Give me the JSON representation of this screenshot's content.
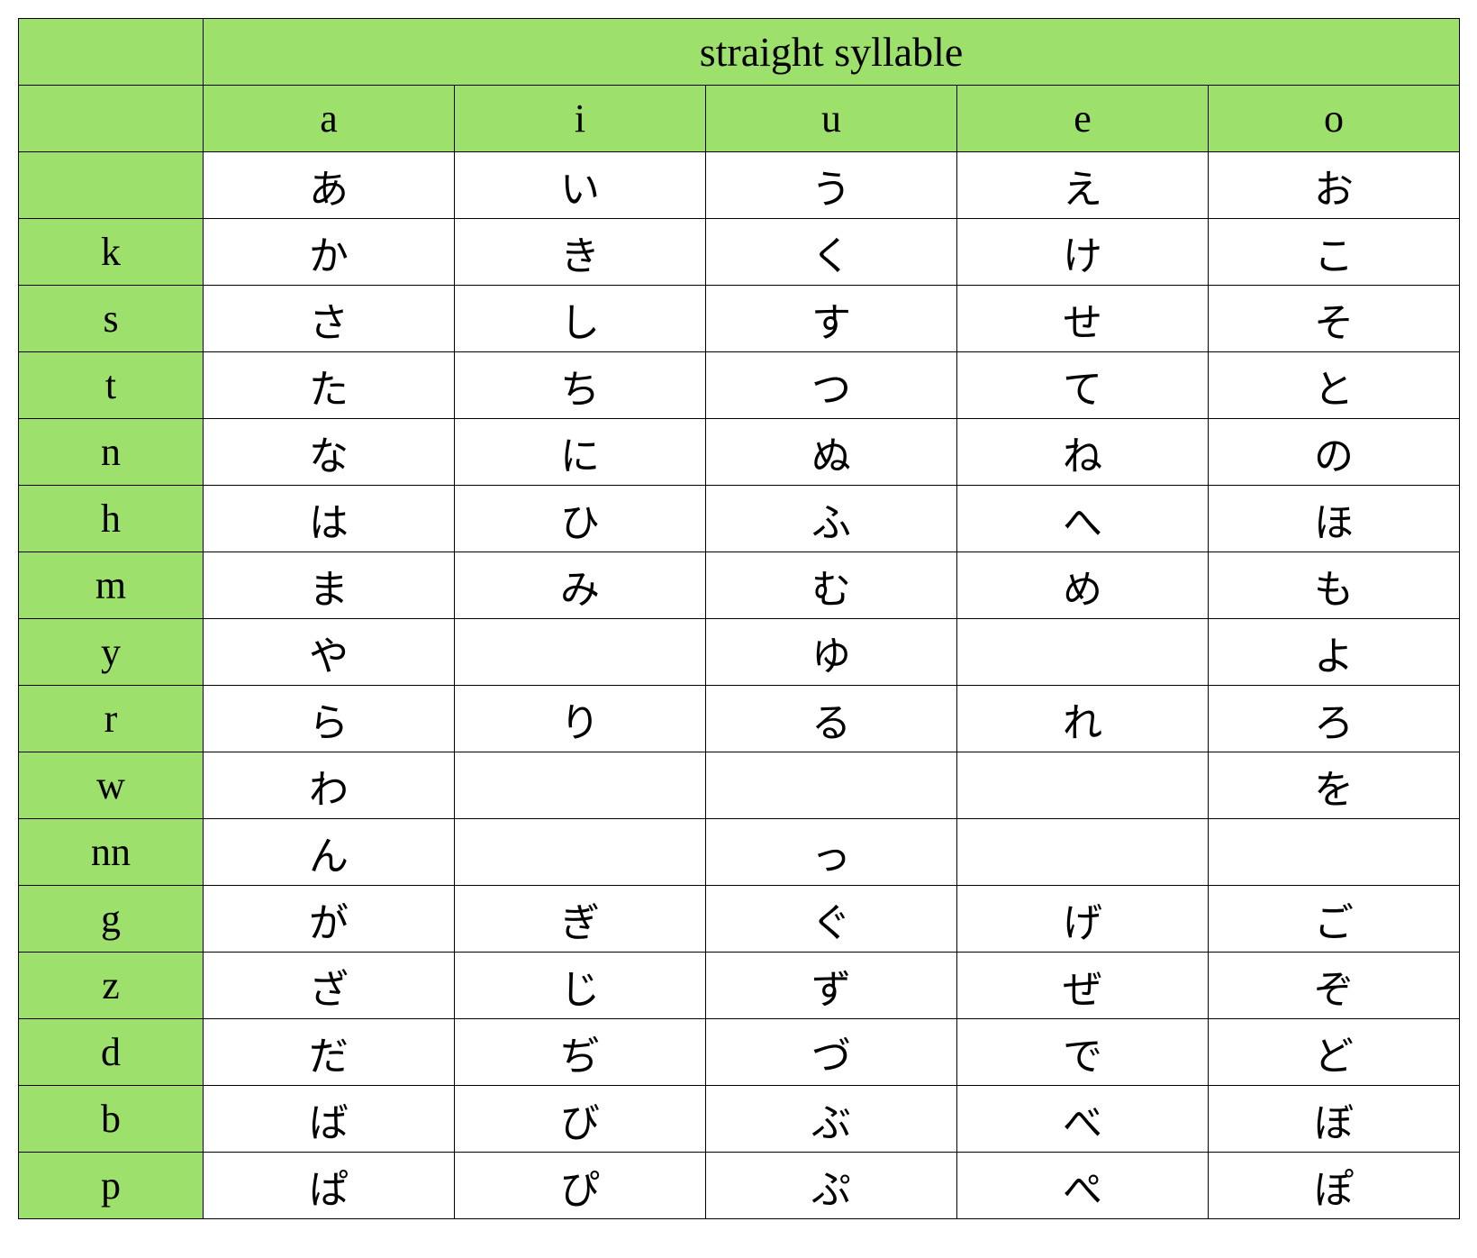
{
  "chart_data": {
    "type": "table",
    "title": "straight syllable",
    "columns": [
      "a",
      "i",
      "u",
      "e",
      "o"
    ],
    "rows": [
      {
        "label": "",
        "cells": [
          "あ",
          "い",
          "う",
          "え",
          "お"
        ]
      },
      {
        "label": "k",
        "cells": [
          "か",
          "き",
          "く",
          "け",
          "こ"
        ]
      },
      {
        "label": "s",
        "cells": [
          "さ",
          "し",
          "す",
          "せ",
          "そ"
        ]
      },
      {
        "label": "t",
        "cells": [
          "た",
          "ち",
          "つ",
          "て",
          "と"
        ]
      },
      {
        "label": "n",
        "cells": [
          "な",
          "に",
          "ぬ",
          "ね",
          "の"
        ]
      },
      {
        "label": "h",
        "cells": [
          "は",
          "ひ",
          "ふ",
          "へ",
          "ほ"
        ]
      },
      {
        "label": "m",
        "cells": [
          "ま",
          "み",
          "む",
          "め",
          "も"
        ]
      },
      {
        "label": "y",
        "cells": [
          "や",
          "",
          "ゆ",
          "",
          "よ"
        ]
      },
      {
        "label": "r",
        "cells": [
          "ら",
          "り",
          "る",
          "れ",
          "ろ"
        ]
      },
      {
        "label": "w",
        "cells": [
          "わ",
          "",
          "",
          "",
          "を"
        ]
      },
      {
        "label": "nn",
        "cells": [
          "ん",
          "",
          "っ",
          "",
          ""
        ]
      },
      {
        "label": "g",
        "cells": [
          "が",
          "ぎ",
          "ぐ",
          "げ",
          "ご"
        ]
      },
      {
        "label": "z",
        "cells": [
          "ざ",
          "じ",
          "ず",
          "ぜ",
          "ぞ"
        ]
      },
      {
        "label": "d",
        "cells": [
          "だ",
          "ぢ",
          "づ",
          "で",
          "ど"
        ]
      },
      {
        "label": "b",
        "cells": [
          "ば",
          "び",
          "ぶ",
          "べ",
          "ぼ"
        ]
      },
      {
        "label": "p",
        "cells": [
          "ぱ",
          "ぴ",
          "ぷ",
          "ぺ",
          "ぽ"
        ]
      }
    ]
  }
}
